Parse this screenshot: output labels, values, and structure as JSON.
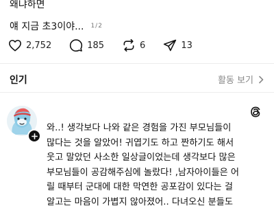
{
  "post": {
    "line1": "왜냐하면",
    "line2": "얘 지금 초3이야...",
    "page_indicator": "1/2"
  },
  "actions": {
    "likes": "2,752",
    "replies": "185",
    "reposts": "6",
    "shares": "13"
  },
  "sort": {
    "title": "인기",
    "toggle_label": "활동 보기"
  },
  "comment": {
    "lines": [
      "와..! 생각보다 나와 같은 경험을 가진 부모님들이",
      "많다는 것을 알았어! 귀엽기도 하고 짠하기도 해서",
      "웃고 말았던 사소한 일상글이었는데 생각보다 많은",
      "부모님들이 공감해주심에 놀랐다! ,남자아이들은 어",
      "릴 때부터 군대에 대한 막연한 공포감이 있다는 걸",
      "알고는 마음이 가볍지 않아졌어.. 다녀오신 분들도"
    ]
  },
  "colors": {
    "text": "#111111",
    "muted": "#888888",
    "divider": "#ececec"
  },
  "icons": [
    "heart-icon",
    "comment-icon",
    "repost-icon",
    "share-icon",
    "chevron-right-icon",
    "plus-icon",
    "threads-logo-icon"
  ]
}
